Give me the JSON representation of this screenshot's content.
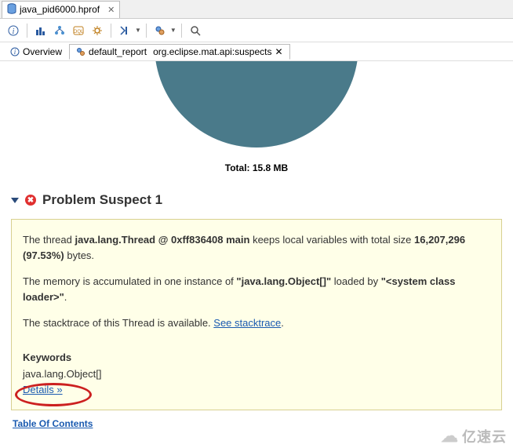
{
  "tab": {
    "label": "java_pid6000.hprof"
  },
  "inner_tabs": {
    "overview": "Overview",
    "report_left": "default_report",
    "report_right": "org.eclipse.mat.api:suspects"
  },
  "chart_data": {
    "type": "pie",
    "series": [
      {
        "name": "Problem Suspect 1",
        "value": 97.53
      }
    ],
    "total_label": "Total: 15.8 MB"
  },
  "section": {
    "title": "Problem Suspect 1"
  },
  "suspect": {
    "p1_a": "The thread ",
    "p1_b": "java.lang.Thread @ 0xff836408 main",
    "p1_c": " keeps local variables with total size ",
    "p1_d": "16,207,296 (97.53%)",
    "p1_e": " bytes.",
    "p2_a": "The memory is accumulated in one instance of ",
    "p2_b": "\"java.lang.Object[]\"",
    "p2_c": " loaded by ",
    "p2_d": "\"<system class loader>\"",
    "p2_e": ".",
    "p3_a": "The stacktrace of this Thread is available. ",
    "p3_link": "See stacktrace",
    "p3_b": ".",
    "kw_label": "Keywords",
    "kw_value": "java.lang.Object[]",
    "details": "Details »"
  },
  "toc": "Table Of Contents",
  "watermark": "亿速云"
}
